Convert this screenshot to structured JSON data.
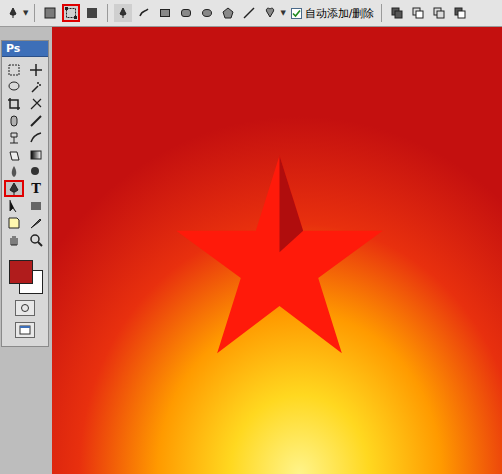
{
  "app": {
    "name": "Photoshop"
  },
  "options_bar": {
    "modes": [
      {
        "selected": false
      },
      {
        "selected": true
      },
      {
        "selected": false
      }
    ],
    "shape_tools": [
      {
        "selected": true
      },
      {
        "selected": false
      },
      {
        "selected": false
      },
      {
        "selected": false
      },
      {
        "selected": false
      },
      {
        "selected": false
      },
      {
        "selected": false
      },
      {
        "selected": false
      }
    ],
    "auto_add_delete": {
      "label": "自动添加/删除",
      "checked": true
    },
    "combine_modes": [
      {
        "selected": false
      },
      {
        "selected": false
      },
      {
        "selected": false
      },
      {
        "selected": false
      }
    ]
  },
  "toolbox": {
    "header": "Ps",
    "tools": [
      {
        "selected": false,
        "glyph": ""
      },
      {
        "selected": false,
        "glyph": ""
      },
      {
        "selected": false,
        "glyph": ""
      },
      {
        "selected": false,
        "glyph": ""
      },
      {
        "selected": false,
        "glyph": ""
      },
      {
        "selected": false,
        "glyph": ""
      },
      {
        "selected": false,
        "glyph": ""
      },
      {
        "selected": false,
        "glyph": ""
      },
      {
        "selected": false,
        "glyph": ""
      },
      {
        "selected": false,
        "glyph": ""
      },
      {
        "selected": false,
        "glyph": ""
      },
      {
        "selected": false,
        "glyph": ""
      },
      {
        "selected": false,
        "glyph": ""
      },
      {
        "selected": false,
        "glyph": ""
      },
      {
        "selected": true,
        "glyph": ""
      },
      {
        "selected": false,
        "glyph": "T"
      },
      {
        "selected": false,
        "glyph": ""
      },
      {
        "selected": false,
        "glyph": ""
      },
      {
        "selected": false,
        "glyph": ""
      },
      {
        "selected": false,
        "glyph": ""
      },
      {
        "selected": false,
        "glyph": ""
      },
      {
        "selected": false,
        "glyph": ""
      }
    ],
    "foreground_color": "#b01c1c",
    "background_color": "#ffffff"
  },
  "canvas": {
    "kind": "photo"
  }
}
